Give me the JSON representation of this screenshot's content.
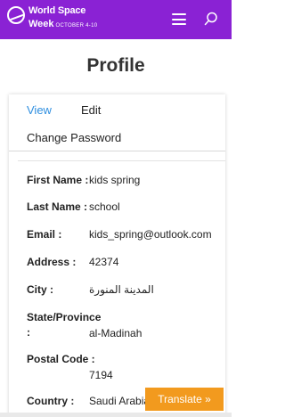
{
  "header": {
    "logo_line1": "World Space",
    "logo_line2": "Week",
    "logo_dates": "OCTOBER 4-10",
    "brand_color": "#8a22d4"
  },
  "page": {
    "title": "Profile"
  },
  "tabs": {
    "view": "View",
    "edit": "Edit",
    "change_password": "Change Password",
    "active_color": "#2f8fe0"
  },
  "fields": [
    {
      "label": "First Name :",
      "value": "kids spring"
    },
    {
      "label": "Last Name :",
      "value": "school"
    },
    {
      "label": "Email :",
      "value": "kids_spring@outlook.com"
    },
    {
      "label": "Address :",
      "value": "42374"
    },
    {
      "label": "City :",
      "value": "المدينة المنورة"
    },
    {
      "label": "State/Province :",
      "value": "al-Madinah"
    },
    {
      "label": "Postal Code :",
      "value": "7194"
    },
    {
      "label": "Country :",
      "value": "Saudi Arabia"
    }
  ],
  "translate": {
    "label": "Translate »",
    "color": "#f29a1e"
  }
}
